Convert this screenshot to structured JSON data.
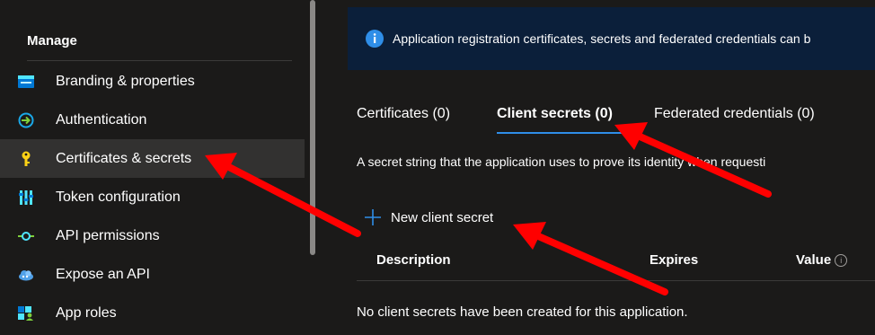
{
  "sidebar": {
    "section_title": "Manage",
    "items": [
      {
        "label": "Branding & properties",
        "icon": "branding-icon"
      },
      {
        "label": "Authentication",
        "icon": "authentication-icon"
      },
      {
        "label": "Certificates & secrets",
        "icon": "key-icon",
        "active": true
      },
      {
        "label": "Token configuration",
        "icon": "token-config-icon"
      },
      {
        "label": "API permissions",
        "icon": "api-permissions-icon"
      },
      {
        "label": "Expose an API",
        "icon": "cloud-icon"
      },
      {
        "label": "App roles",
        "icon": "app-roles-icon"
      }
    ]
  },
  "banner": {
    "text": "Application registration certificates, secrets and federated credentials can b"
  },
  "tabs": [
    {
      "label": "Certificates (0)"
    },
    {
      "label": "Client secrets (0)",
      "active": true
    },
    {
      "label": "Federated credentials (0)"
    }
  ],
  "description": "A secret string that the application uses to prove its identity when requesti",
  "new_secret_label": "New client secret",
  "table": {
    "columns": [
      "Description",
      "Expires",
      "Value"
    ],
    "empty_message": "No client secrets have been created for this application."
  },
  "colors": {
    "accent": "#2f8ee8",
    "banner_bg": "#0b1f3a",
    "annotation_arrow": "#ff0000",
    "active_nav_bg": "#323130"
  }
}
